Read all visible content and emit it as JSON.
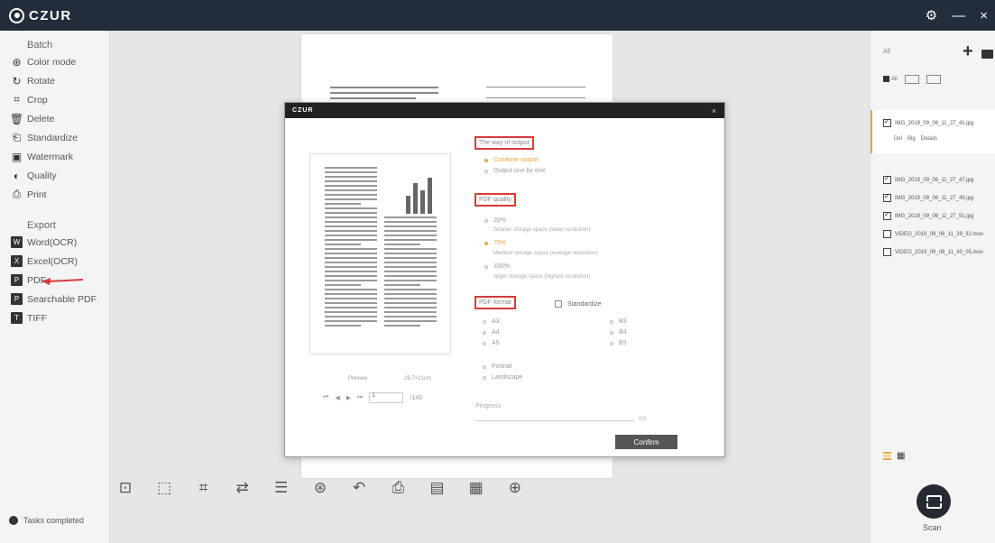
{
  "app": {
    "title": "CZUR"
  },
  "titlebar": {
    "settings_icon": "gear-icon",
    "minimize": "—",
    "close": "×"
  },
  "sidebar": {
    "batch_heading": "Batch",
    "batch_items": [
      {
        "label": "Color mode",
        "icon": "color-mode-icon",
        "glyph": "⊛"
      },
      {
        "label": "Rotate",
        "icon": "rotate-icon",
        "glyph": "↻"
      },
      {
        "label": "Crop",
        "icon": "crop-icon",
        "glyph": "⌗"
      },
      {
        "label": "Delete",
        "icon": "trash-icon",
        "glyph": "🗑"
      },
      {
        "label": "Standardize",
        "icon": "standardize-icon",
        "glyph": "⎗"
      },
      {
        "label": "Watermark",
        "icon": "watermark-icon",
        "glyph": "▣"
      },
      {
        "label": "Quality",
        "icon": "quality-icon",
        "glyph": "◐"
      },
      {
        "label": "Print",
        "icon": "print-icon",
        "glyph": "⎙"
      }
    ],
    "export_heading": "Export",
    "export_items": [
      {
        "label": "Word(OCR)",
        "icon": "word-icon",
        "glyph": "W"
      },
      {
        "label": "Excel(OCR)",
        "icon": "excel-icon",
        "glyph": "X"
      },
      {
        "label": "PDF",
        "icon": "pdf-icon",
        "glyph": "P"
      },
      {
        "label": "Searchable PDF",
        "icon": "searchable-pdf-icon",
        "glyph": "P"
      },
      {
        "label": "TIFF",
        "icon": "tiff-icon",
        "glyph": "T"
      }
    ],
    "tasks_status": "Tasks completed"
  },
  "dialog": {
    "title": "CZUR",
    "close": "×",
    "preview_label": "Preview",
    "preview_size": "29.7×21cm",
    "nav_first": "⏮",
    "nav_prev": "◀",
    "nav_next": "▶",
    "nav_last": "⏭",
    "page_input": "1",
    "page_total": "/140",
    "output_heading": "The way of output",
    "output_options": [
      {
        "label": "Combine output",
        "selected": true
      },
      {
        "label": "Output one by one",
        "selected": false
      }
    ],
    "quality_heading": "PDF quality",
    "quality_options": [
      {
        "label": "20%",
        "desc": "Smaller storage space (lower resolution)",
        "selected": false
      },
      {
        "label": "75%",
        "desc": "Medium storage space (average resolution)",
        "selected": true
      },
      {
        "label": "100%",
        "desc": "larger storage space (highest resolution)",
        "selected": false
      }
    ],
    "format_heading": "PDF format",
    "standardize_label": "Standardize",
    "sizes_left": [
      "A3",
      "A4",
      "A5"
    ],
    "sizes_right": [
      "B3",
      "B4",
      "B5"
    ],
    "orientation": [
      "Portrait",
      "Landscape"
    ],
    "progress_label": "Progress",
    "progress_value": "0/2",
    "confirm_label": "Confirm"
  },
  "toolbar": [
    {
      "name": "fit-page-icon",
      "glyph": "⊡"
    },
    {
      "name": "select-area-icon",
      "glyph": "⬚"
    },
    {
      "name": "crop-icon",
      "glyph": "⌗"
    },
    {
      "name": "rotate-icon",
      "glyph": "⇄"
    },
    {
      "name": "adjust-icon",
      "glyph": "☰"
    },
    {
      "name": "color-mode-icon",
      "glyph": "⊛"
    },
    {
      "name": "undo-icon",
      "glyph": "↶"
    },
    {
      "name": "print-icon",
      "glyph": "⎙"
    },
    {
      "name": "ocr-icon",
      "glyph": "▤"
    },
    {
      "name": "barcode-icon",
      "glyph": "▦"
    },
    {
      "name": "center-icon",
      "glyph": "⊕"
    }
  ],
  "right_panel": {
    "all_label": "All",
    "filter_all": "All",
    "files": [
      {
        "name": "IMG_2019_09_06_11_27_41.jpg",
        "checked": true
      },
      {
        "name": "IMG_2019_09_06_11_27_47.jpg",
        "checked": true
      },
      {
        "name": "IMG_2019_09_06_11_27_49.jpg",
        "checked": true
      },
      {
        "name": "IMG_2019_09_06_11_27_51.jpg",
        "checked": true
      },
      {
        "name": "VIDEO_2019_09_06_11_39_32.mov",
        "checked": false
      },
      {
        "name": "VIDEO_2019_09_06_11_40_05.mov",
        "checked": false
      }
    ],
    "file_actions": [
      "Del",
      "Big",
      "Details"
    ],
    "scan_label": "Scan"
  },
  "colors": {
    "titlebar": "#232c3a",
    "accent": "#e8a63a",
    "highlight": "#d83a3a"
  }
}
